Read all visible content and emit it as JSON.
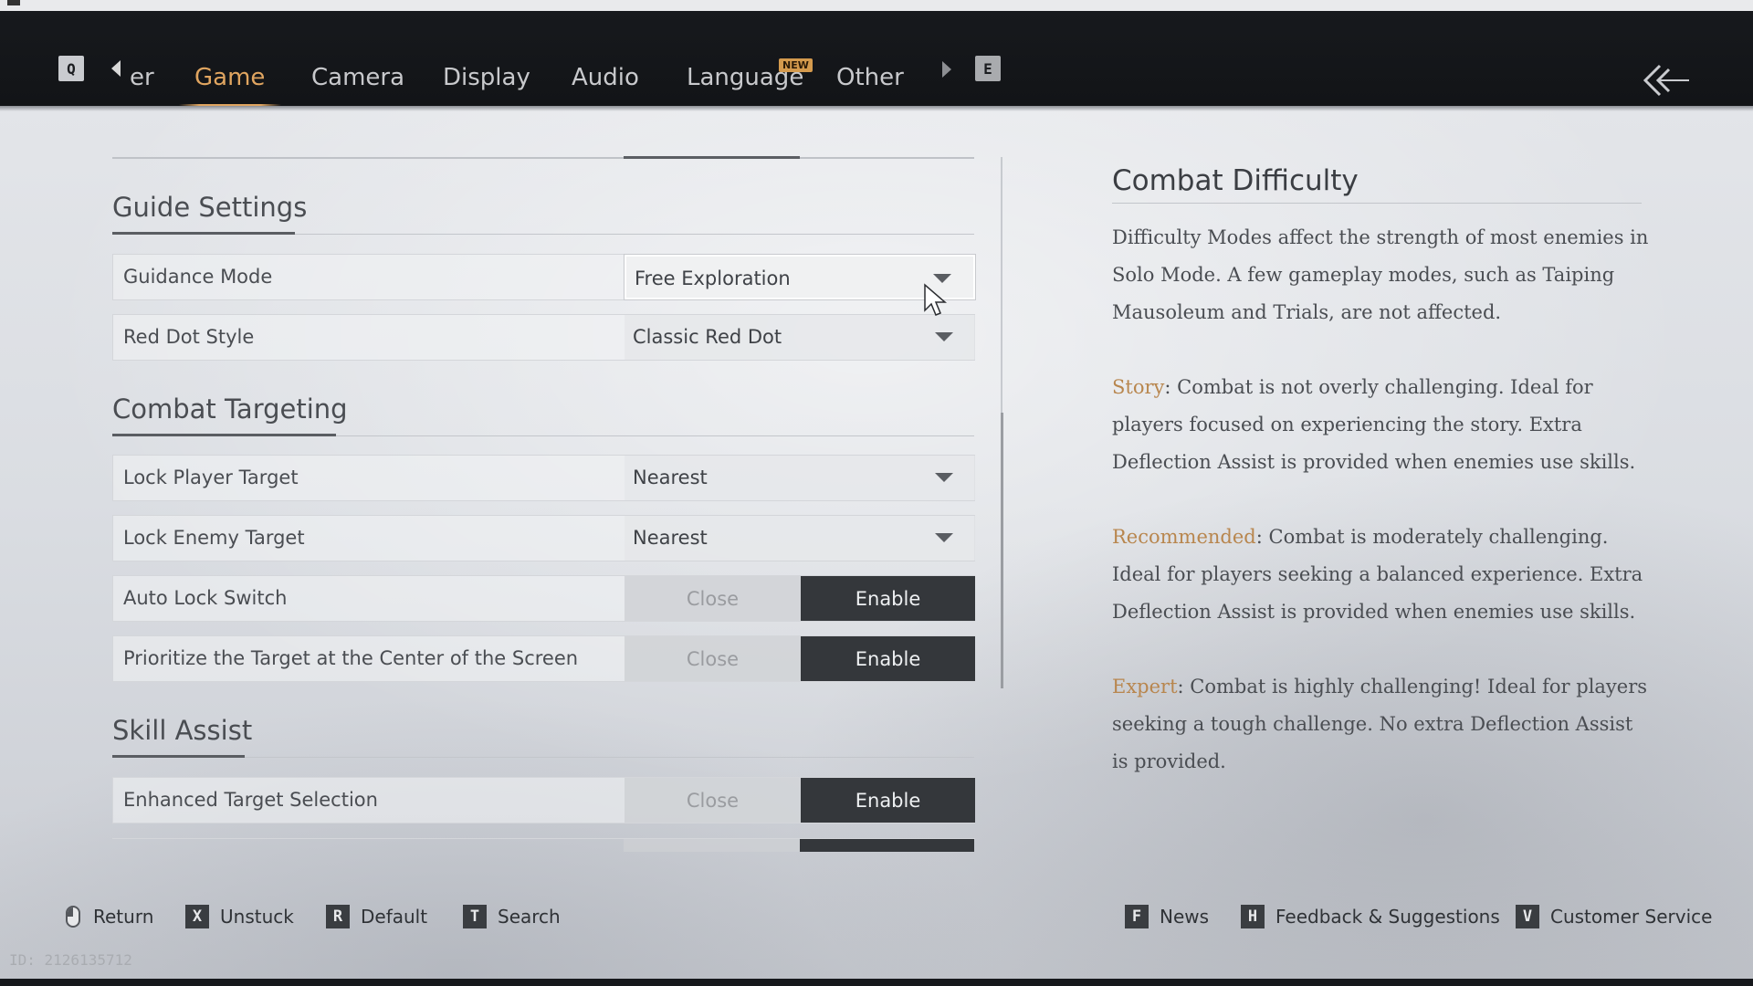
{
  "nav": {
    "left_key": "Q",
    "right_key": "E",
    "tabs": [
      {
        "label": "er",
        "active": false
      },
      {
        "label": "Game",
        "active": true
      },
      {
        "label": "Camera",
        "active": false
      },
      {
        "label": "Display",
        "active": false
      },
      {
        "label": "Audio",
        "active": false
      },
      {
        "label": "Language",
        "active": false,
        "badge": "NEW"
      },
      {
        "label": "Other",
        "active": false
      }
    ],
    "back_icon": "double-chevron-left-icon"
  },
  "sections": {
    "guide": {
      "title": "Guide Settings",
      "rows": [
        {
          "label": "Guidance Mode",
          "value": "Free Exploration"
        },
        {
          "label": "Red Dot Style",
          "value": "Classic Red Dot"
        }
      ]
    },
    "combat": {
      "title": "Combat Targeting",
      "rows": [
        {
          "label": "Lock Player Target",
          "value": "Nearest"
        },
        {
          "label": "Lock Enemy Target",
          "value": "Nearest"
        },
        {
          "label": "Auto Lock Switch",
          "off": "Close",
          "on": "Enable",
          "selected": "Enable"
        },
        {
          "label": "Prioritize the Target at the Center of the Screen",
          "off": "Close",
          "on": "Enable",
          "selected": "Enable"
        }
      ]
    },
    "skill": {
      "title": "Skill Assist",
      "rows": [
        {
          "label": "Enhanced Target Selection",
          "off": "Close",
          "on": "Enable",
          "selected": "Enable"
        }
      ]
    }
  },
  "description": {
    "title": "Combat Difficulty",
    "intro": "Difficulty Modes affect the strength of most enemies in Solo Mode. A few gameplay modes, such as Taiping Mausoleum and Trials, are not affected.",
    "modes": [
      {
        "name": "Story",
        "text": ": Combat is not overly challenging. Ideal for players focused on experiencing the story. Extra Deflection Assist is provided when enemies use skills."
      },
      {
        "name": "Recommended",
        "text": ": Combat is moderately challenging. Ideal for players seeking a balanced experience. Extra Deflection Assist is provided when enemies use skills."
      },
      {
        "name": "Expert",
        "text": ": Combat is highly challenging! Ideal for players seeking a tough challenge. No extra Deflection Assist is provided."
      }
    ],
    "keyword_color": "#b8864e"
  },
  "footer": {
    "left": [
      {
        "key": "mouse-icon",
        "label": "Return"
      },
      {
        "key": "X",
        "label": "Unstuck"
      },
      {
        "key": "R",
        "label": "Default"
      },
      {
        "key": "T",
        "label": "Search"
      }
    ],
    "right": [
      {
        "key": "F",
        "label": "News"
      },
      {
        "key": "H",
        "label": "Feedback & Suggestions"
      },
      {
        "key": "V",
        "label": "Customer Service"
      }
    ],
    "id_text": "ID: 2126135712"
  },
  "colors": {
    "active_tab": "#e0a560",
    "enable_button": "#34373b"
  }
}
